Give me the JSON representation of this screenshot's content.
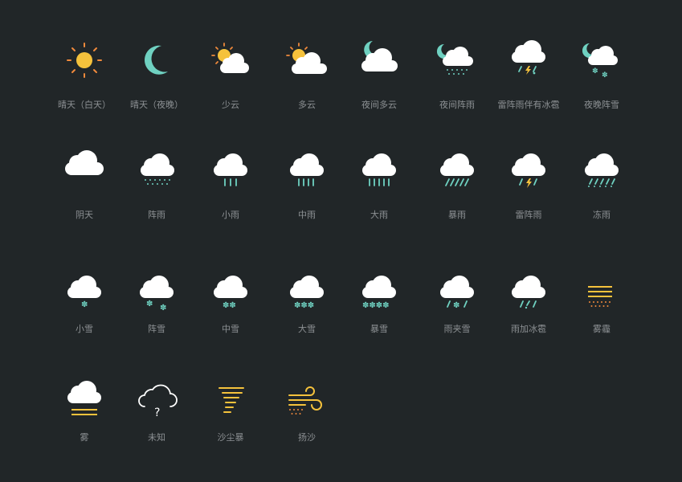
{
  "colors": {
    "background": "#212628",
    "cloud": "#ffffff",
    "sun": "#f5c23c",
    "sun_rays": "#f08a3c",
    "moon": "#6fd1c1",
    "rain": "#6fd1c1",
    "snow": "#6fd1c1",
    "lightning": "#f5c23c",
    "fog": "#f5c23c",
    "dust": "#f08a3c",
    "label": "#8c9093"
  },
  "icons": [
    {
      "label": "晴天（白天）",
      "icon": "sunny-day-icon"
    },
    {
      "label": "晴天（夜晚）",
      "icon": "clear-night-icon"
    },
    {
      "label": "少云",
      "icon": "few-clouds-icon"
    },
    {
      "label": "多云",
      "icon": "cloudy-icon"
    },
    {
      "label": "夜间多云",
      "icon": "night-cloudy-icon"
    },
    {
      "label": "夜间阵雨",
      "icon": "night-showers-icon"
    },
    {
      "label": "雷阵雨伴有冰雹",
      "icon": "thunderstorm-hail-icon"
    },
    {
      "label": "夜晚阵雪",
      "icon": "night-snow-showers-icon"
    },
    {
      "label": "阴天",
      "icon": "overcast-icon"
    },
    {
      "label": "阵雨",
      "icon": "showers-icon"
    },
    {
      "label": "小雨",
      "icon": "light-rain-icon"
    },
    {
      "label": "中雨",
      "icon": "moderate-rain-icon"
    },
    {
      "label": "大雨",
      "icon": "heavy-rain-icon"
    },
    {
      "label": "暴雨",
      "icon": "rainstorm-icon"
    },
    {
      "label": "雷阵雨",
      "icon": "thunder-shower-icon"
    },
    {
      "label": "冻雨",
      "icon": "freezing-rain-icon"
    },
    {
      "label": "小雪",
      "icon": "light-snow-icon"
    },
    {
      "label": "阵雪",
      "icon": "snow-showers-icon"
    },
    {
      "label": "中雪",
      "icon": "moderate-snow-icon"
    },
    {
      "label": "大雪",
      "icon": "heavy-snow-icon"
    },
    {
      "label": "暴雪",
      "icon": "blizzard-icon"
    },
    {
      "label": "雨夹雪",
      "icon": "sleet-icon"
    },
    {
      "label": "雨加冰雹",
      "icon": "rain-hail-icon"
    },
    {
      "label": "雾霾",
      "icon": "haze-icon"
    },
    {
      "label": "雾",
      "icon": "fog-icon"
    },
    {
      "label": "未知",
      "icon": "unknown-icon"
    },
    {
      "label": "沙尘暴",
      "icon": "sandstorm-icon"
    },
    {
      "label": "扬沙",
      "icon": "blowing-sand-icon"
    }
  ]
}
